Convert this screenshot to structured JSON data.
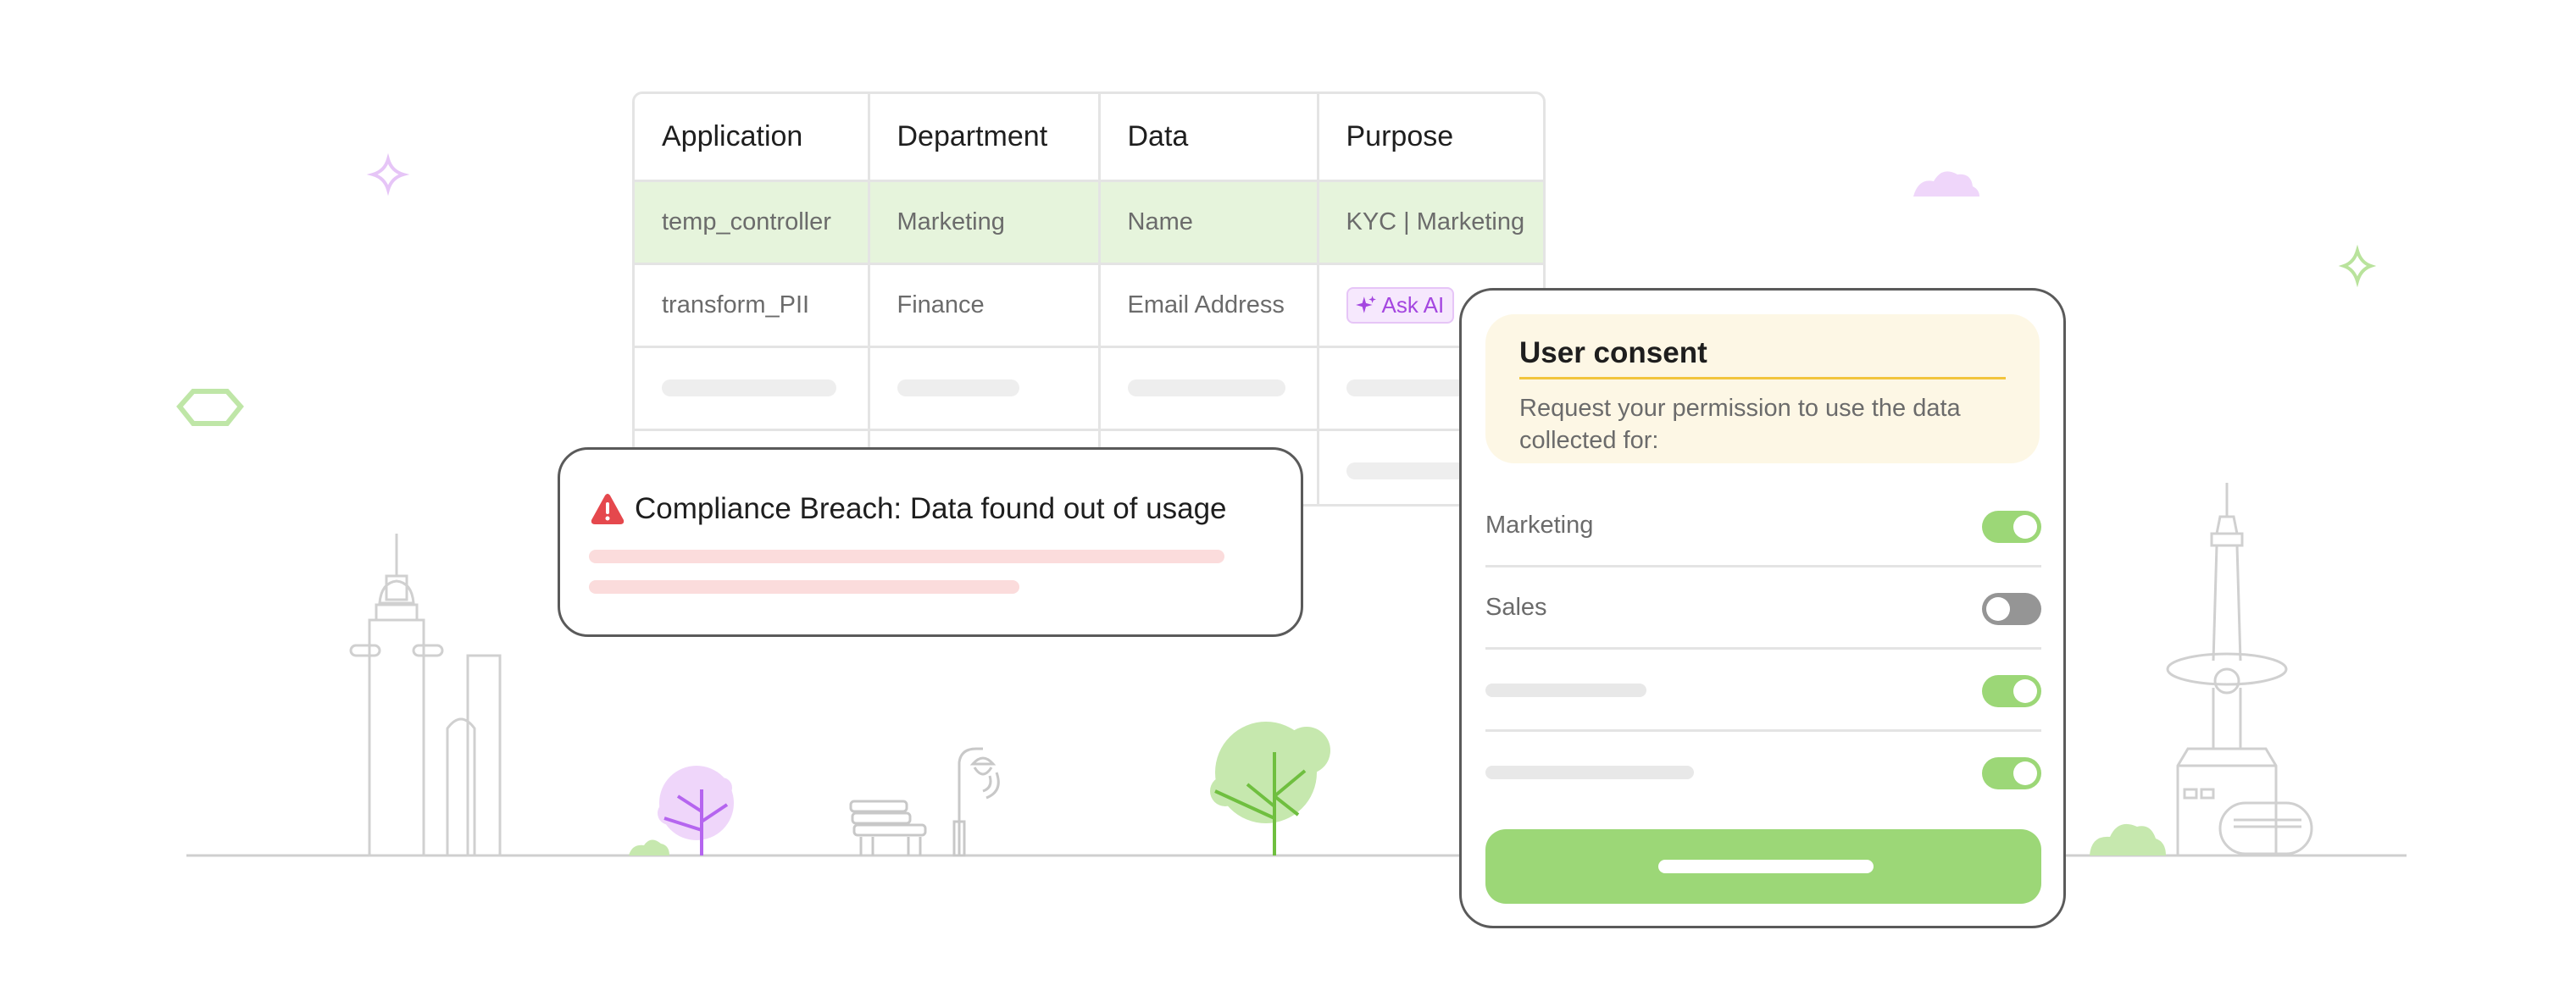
{
  "colors": {
    "accent_green": "#9cd777",
    "highlight_row": "#e6f4dc",
    "ai_purple": "#a446e0",
    "alert_red": "#e5484d",
    "consent_bg": "#fdf7e5",
    "consent_rule": "#f2c53d",
    "line_gray": "#cfcfcf"
  },
  "table": {
    "headers": [
      "Application",
      "Department",
      "Data",
      "Purpose"
    ],
    "rows": [
      {
        "application": "temp_controller",
        "department": "Marketing",
        "data": "Name",
        "purpose": "KYC | Marketing",
        "highlighted": true
      },
      {
        "application": "transform_PII",
        "department": "Finance",
        "data": "Email Address",
        "purpose_action": "Ask AI",
        "purpose_icon": "sparkle-icon"
      }
    ]
  },
  "alert": {
    "icon": "warning-triangle-icon",
    "title": "Compliance Breach: Data found out of usage"
  },
  "consent": {
    "title": "User consent",
    "description": "Request your permission to use the data collected for:",
    "items": [
      {
        "label": "Marketing",
        "enabled": true
      },
      {
        "label": "Sales",
        "enabled": false
      },
      {
        "label": "",
        "enabled": true
      },
      {
        "label": "",
        "enabled": true
      }
    ]
  }
}
